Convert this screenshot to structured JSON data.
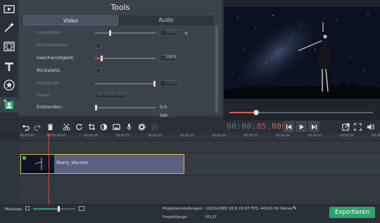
{
  "tools": {
    "title": "Tools",
    "tabs": [
      {
        "label": "Video",
        "active": true
      },
      {
        "label": "Audio",
        "active": false
      }
    ],
    "properties": [
      {
        "label": "Lautstärke:",
        "value": "100%",
        "enabled": false,
        "type": "slider",
        "level": 0.24
      },
      {
        "label": "Normalisieren:",
        "enabled": false,
        "type": "checkbox"
      },
      {
        "label": "Geschwindigkeit:",
        "value": "100%",
        "enabled": true,
        "type": "slider",
        "level": 0.1
      },
      {
        "label": "Rückwärts:",
        "enabled": true,
        "type": "checkbox"
      },
      {
        "label": "Deckkraft:",
        "value": "100%",
        "enabled": false,
        "type": "slider",
        "level": 1.0
      },
      {
        "label": "Dauer:",
        "value": "00:00:00.000",
        "enabled": false,
        "type": "time"
      },
      {
        "label": "Einblenden:",
        "value": "0,0 Sek.",
        "enabled": true,
        "type": "slider",
        "level": 0.0
      }
    ]
  },
  "sidebar_icons": [
    "film-strip-icon",
    "magic-wand-icon",
    "filmstrip-icon",
    "text-icon",
    "star-icon",
    "user-transfer-icon",
    "list-icon"
  ],
  "player": {
    "timecode_dim": "00:00:",
    "timecode_hl": "05.000",
    "progress": 0.18
  },
  "timeline": {
    "ruler": [
      "00:00:00",
      "00:00:05",
      "00:00:10",
      "00:00:15",
      "00:00:20",
      "00:00:25",
      "00:00:30",
      "00:00:35",
      "00:00:40",
      "00:00:45",
      "00:00:50",
      "00:00:55"
    ],
    "clip_name": "Starry_sky.mov"
  },
  "footer": {
    "scale_label": "Maßstab:",
    "project_settings_label": "Projekteinstellungen:",
    "project_settings_value": "1920x1080 16:9 29.97 FPS, 44100 Hz Stereo",
    "project_length_label": "Projektlänge:",
    "project_length_value": "00:27",
    "export_label": "Exportieren",
    "zoom_level": 0.58
  },
  "colors": {
    "accent": "#d8483a",
    "export": "#2fa36b",
    "clip_border": "#e0b441"
  }
}
